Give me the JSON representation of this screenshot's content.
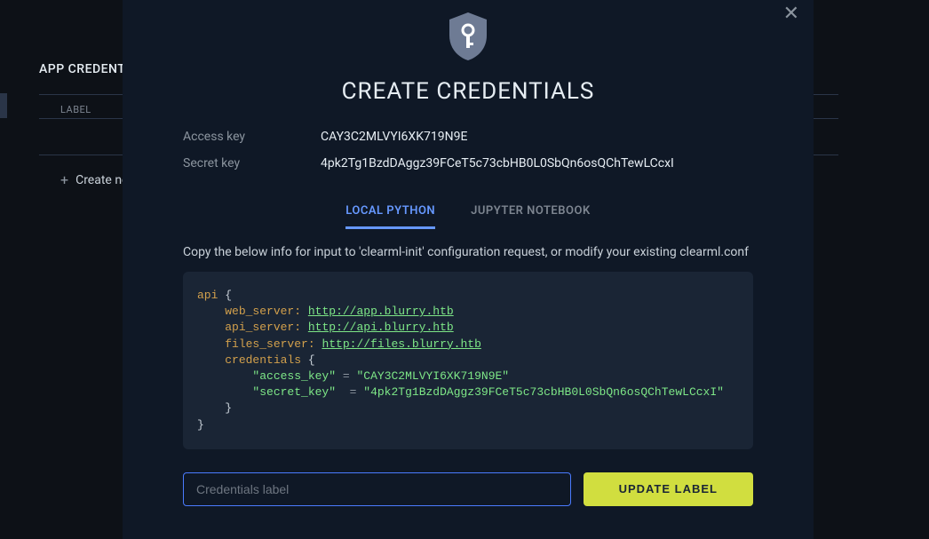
{
  "background": {
    "section_title": "APP CREDENTIALS",
    "label_header": "LABEL",
    "create_new": "Create new credentials"
  },
  "modal": {
    "title": "CREATE CREDENTIALS",
    "access_key_label": "Access key",
    "access_key_value": "CAY3C2MLVYI6XK719N9E",
    "secret_key_label": "Secret key",
    "secret_key_value": "4pk2Tg1BzdDAggz39FCeT5c73cbHB0L0SbQn6osQChTewLCcxI",
    "tabs": {
      "local_python": "LOCAL PYTHON",
      "jupyter": "JUPYTER NOTEBOOK"
    },
    "instruction": "Copy the below info for input to 'clearml-init' configuration request, or modify your existing clearml.conf",
    "code": {
      "api": "api",
      "web_server_key": "web_server:",
      "web_server_val": "http://app.blurry.htb",
      "api_server_key": "api_server:",
      "api_server_val": "http://api.blurry.htb",
      "files_server_key": "files_server:",
      "files_server_val": "http://files.blurry.htb",
      "credentials": "credentials",
      "access_key_k": "\"access_key\"",
      "access_key_v": "\"CAY3C2MLVYI6XK719N9E\"",
      "secret_key_k": "\"secret_key\"",
      "secret_key_v": "\"4pk2Tg1BzdDAggz39FCeT5c73cbHB0L0SbQn6osQChTewLCcxI\""
    },
    "label_placeholder": "Credentials label",
    "update_button": "UPDATE LABEL"
  }
}
